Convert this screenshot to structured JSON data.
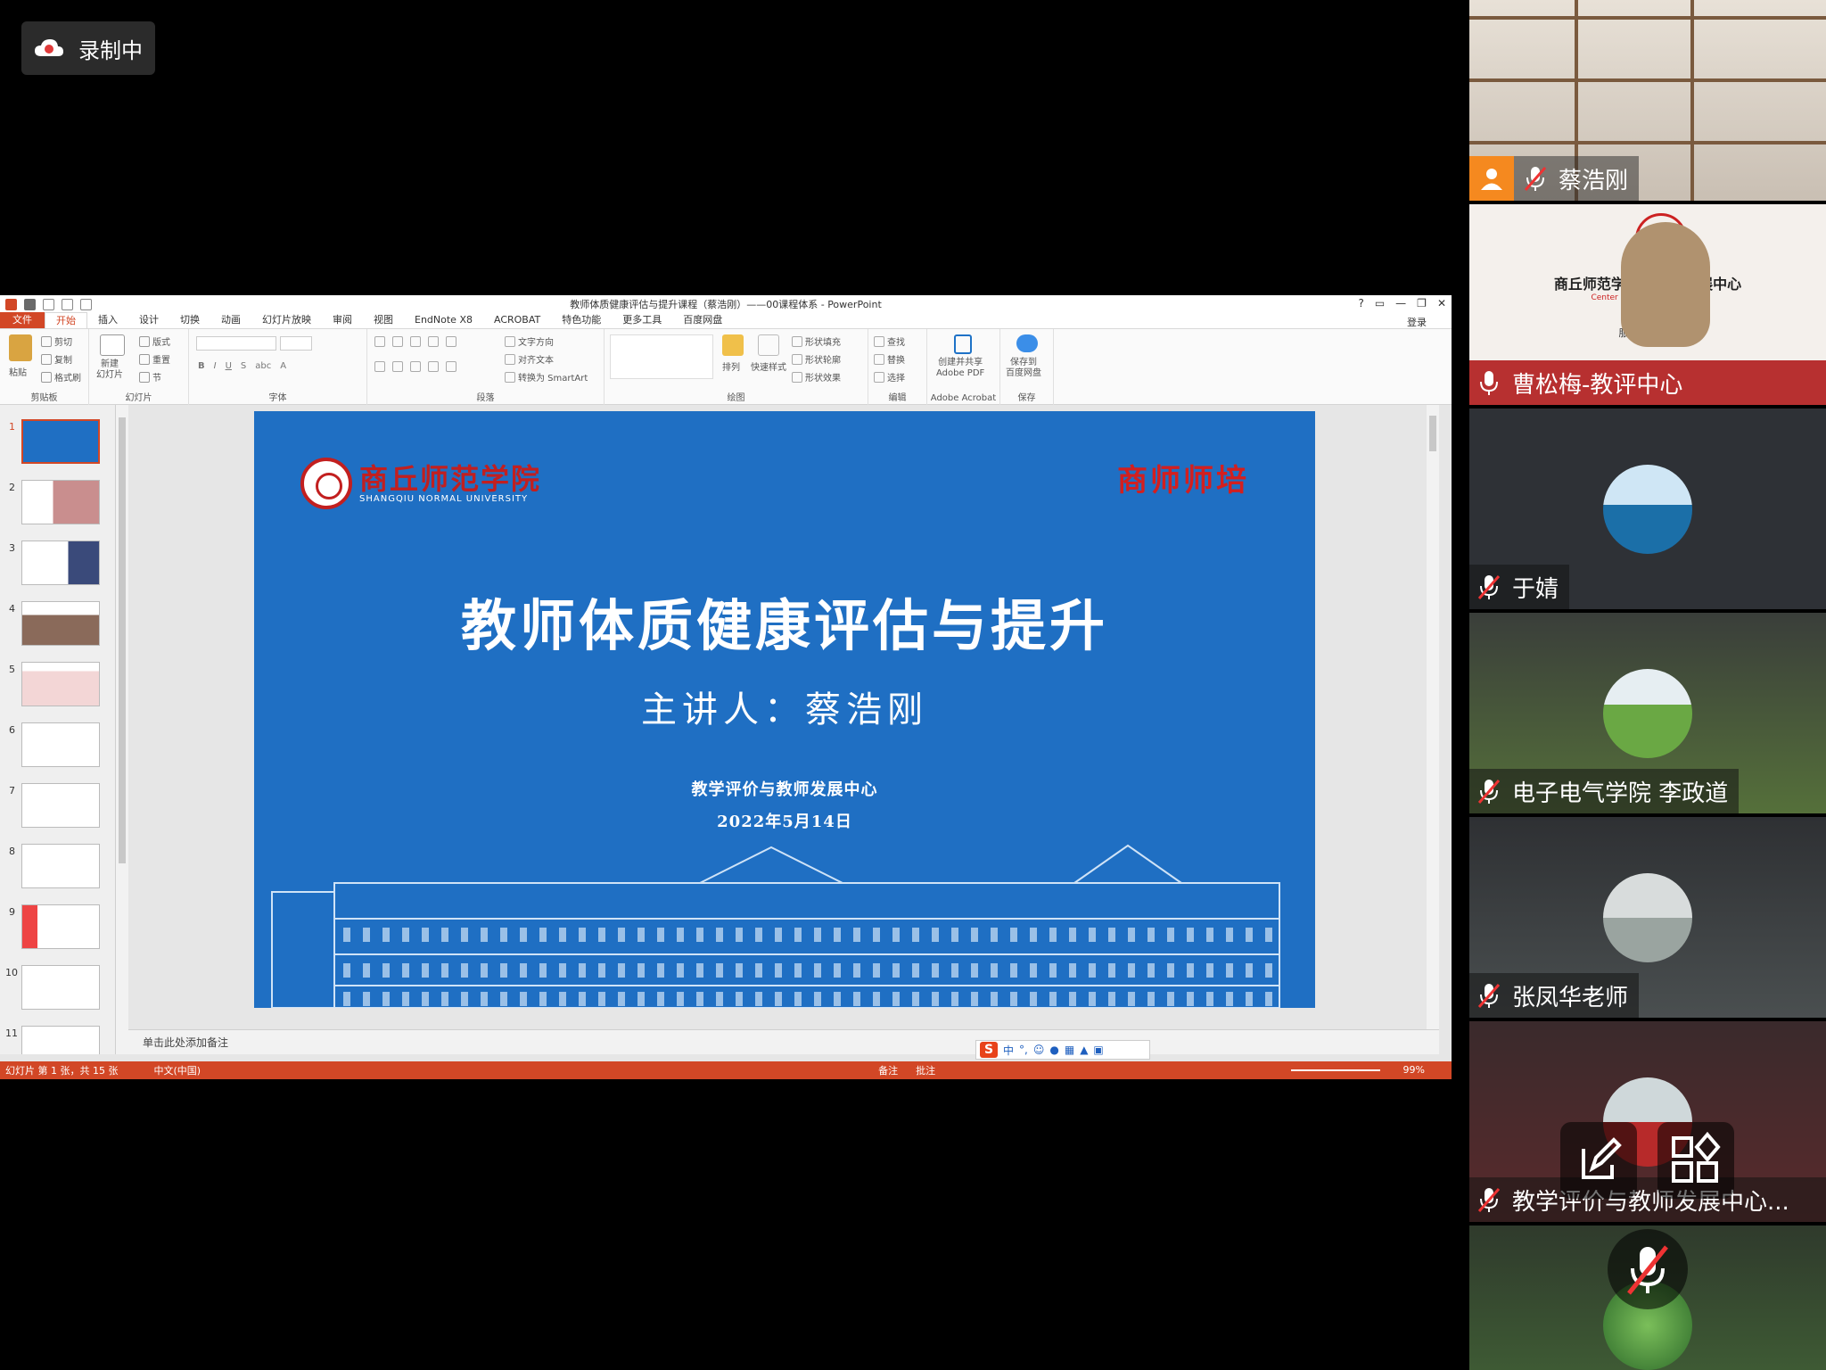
{
  "recording": {
    "label": "录制中"
  },
  "ppt": {
    "window_title": "教师体质健康评估与提升课程（蔡浩刚）——00课程体系 - PowerPoint",
    "window_controls": [
      "?",
      "▭",
      "—",
      "❐",
      "✕"
    ],
    "tabs": [
      "文件",
      "开始",
      "插入",
      "设计",
      "切换",
      "动画",
      "幻灯片放映",
      "审阅",
      "视图",
      "EndNote X8",
      "ACROBAT",
      "特色功能",
      "更多工具",
      "百度网盘"
    ],
    "active_tab": "开始",
    "login": "登录",
    "ribbon": {
      "clipboard": {
        "label": "剪贴板",
        "paste": "粘贴",
        "cut": "剪切",
        "copy": "复制",
        "format_painter": "格式刷"
      },
      "slides": {
        "label": "幻灯片",
        "new_slide": "新建\n幻灯片",
        "layout": "版式",
        "reset": "重置",
        "section": "节"
      },
      "font": {
        "label": "字体"
      },
      "paragraph": {
        "label": "段落",
        "text_direction": "文字方向",
        "align_text": "对齐文本",
        "smartart": "转换为 SmartArt"
      },
      "drawing": {
        "label": "绘图",
        "arrange": "排列",
        "quick_styles": "快速样式",
        "shape_fill": "形状填充",
        "shape_outline": "形状轮廓",
        "shape_effects": "形状效果"
      },
      "editing": {
        "label": "编辑",
        "find": "查找",
        "replace": "替换",
        "select": "选择"
      },
      "acrobat": {
        "label": "Adobe Acrobat",
        "create": "创建并共享\nAdobe PDF"
      },
      "save": {
        "label": "保存",
        "baidu": "保存到\n百度网盘"
      }
    },
    "thumbnails": [
      "1",
      "2",
      "3",
      "4",
      "5",
      "6",
      "7",
      "8",
      "9",
      "10",
      "11"
    ],
    "notes_placeholder": "单击此处添加备注",
    "status": {
      "slide_info": "幻灯片 第 1 张，共 15 张",
      "language": "中文(中国)",
      "notes": "备注",
      "comments": "批注",
      "zoom": "99%"
    },
    "ime": {
      "logo": "S",
      "mode": "中"
    }
  },
  "slide": {
    "logo_cn": "商丘师范学院",
    "logo_en": "SHANGQIU NORMAL UNIVERSITY",
    "tagline": "商师师培",
    "title": "教师体质健康评估与提升",
    "speaker": "主讲人：蔡浩刚",
    "org": "教学评价与教师发展中心",
    "date": "2022年5月14日",
    "bg_color": "#1f6fc3"
  },
  "participants": [
    {
      "name": "蔡浩刚",
      "muted": true
    },
    {
      "name": "曹松梅-教评中心",
      "muted": false,
      "backdrop_title": "商丘师范学院教...师发展中心",
      "backdrop_sub": "Center For Teach...elopment",
      "backdrop_motto": "服务 · 开...师"
    },
    {
      "name": "于婧",
      "muted": true
    },
    {
      "name": "电子电气学院  李政道",
      "muted": true
    },
    {
      "name": "张凤华老师",
      "muted": true
    },
    {
      "name": "教学评价与教师发展中心...",
      "muted": true
    },
    {
      "name": "",
      "muted": true
    }
  ],
  "colors": {
    "ppt_accent": "#d24726",
    "avatar_orange": "#f5891f"
  }
}
